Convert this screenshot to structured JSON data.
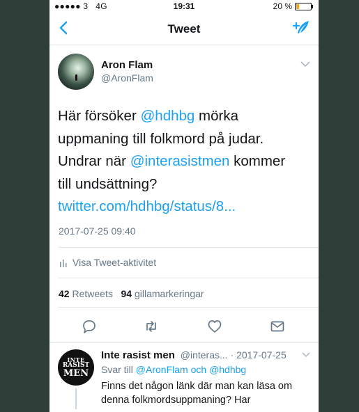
{
  "status_bar": {
    "signal": "●●●●● 3",
    "network": "4G",
    "time": "19:31",
    "battery": "20 %",
    "battery_level": 0.2
  },
  "nav": {
    "title": "Tweet",
    "back_icon": "chevron-left-icon",
    "compose_icon": "compose-quill-icon",
    "accent": "#1da1f2"
  },
  "tweet": {
    "author_name": "Aron Flam",
    "author_handle": "@AronFlam",
    "text_parts": [
      "Här försöker ",
      "@hdhbg",
      " mörka uppmaning till folkmord på judar. Undrar när ",
      "@interasistmen",
      " kommer till undsättning? ",
      "twitter.com/hdhbg/status/8..."
    ],
    "timestamp": "2017-07-25 09:40",
    "activity_label": "Visa Tweet-aktivitet",
    "retweets_count": "42",
    "retweets_label": "Retweets",
    "likes_count": "94",
    "likes_label": "gillamarkeringar"
  },
  "reply": {
    "avatar_text": [
      "INTE",
      "RASIST",
      "MEN"
    ],
    "author_name": "Inte rasist men",
    "author_handle": "@interas...",
    "date": "· 2017-07-25",
    "replying_to_prefix": "Svar till",
    "replying_to_1": "@AronFlam",
    "replying_to_and": "och",
    "replying_to_2": "@hdhbg",
    "text": "Finns det någon länk där man kan läsa om denna folkmordsuppmaning? Har"
  }
}
